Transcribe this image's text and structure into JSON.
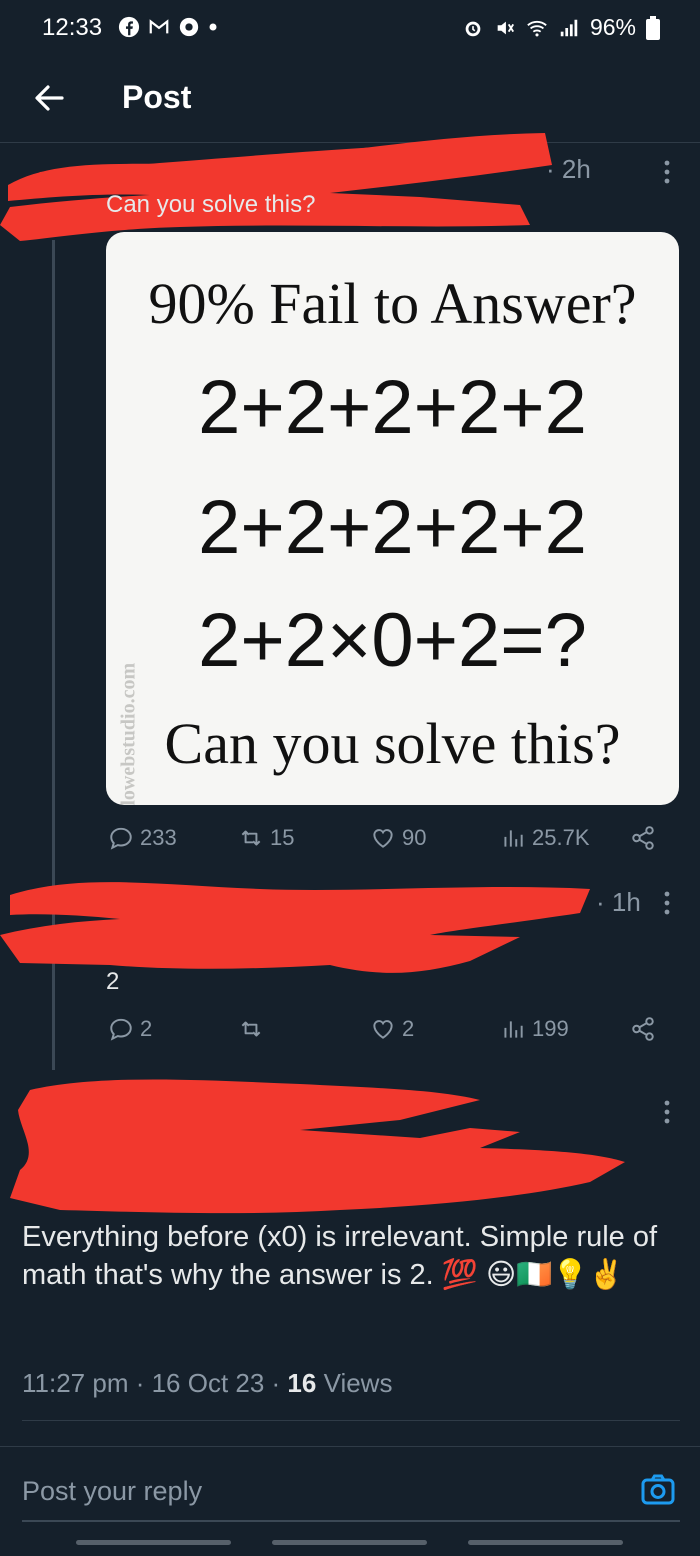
{
  "status_bar": {
    "time": "12:33",
    "battery": "96%"
  },
  "header": {
    "title": "Post"
  },
  "original_post": {
    "time": "· 2h",
    "text": "Can you solve this?",
    "image": {
      "title": "90% Fail to Answer?",
      "line1": "2+2+2+2+2",
      "line2": "2+2+2+2+2",
      "line3": "2+2×0+2=?",
      "footer": "Can you solve this?",
      "watermark": "Simplowebstudio.com"
    },
    "actions": {
      "replies": "233",
      "reposts": "15",
      "likes": "90",
      "views": "25.7K"
    }
  },
  "reply_post": {
    "time": "· 1h",
    "text": "2",
    "actions": {
      "replies": "2",
      "reposts": "",
      "likes": "2",
      "views": "199"
    }
  },
  "main_post": {
    "text": "Everything before (x0) is irrelevant. Simple rule of math that's why the answer is 2. 💯 😃🇮🇪💡✌️",
    "time": "11:27 pm · 16 Oct 23 · ",
    "views_count": "16",
    "views_label": " Views"
  },
  "reply_box": {
    "placeholder": "Post your reply"
  },
  "colors": {
    "background": "#15202b",
    "accent": "#1d9bf0",
    "scribble": "#f2382e",
    "muted": "#8b98a5"
  }
}
